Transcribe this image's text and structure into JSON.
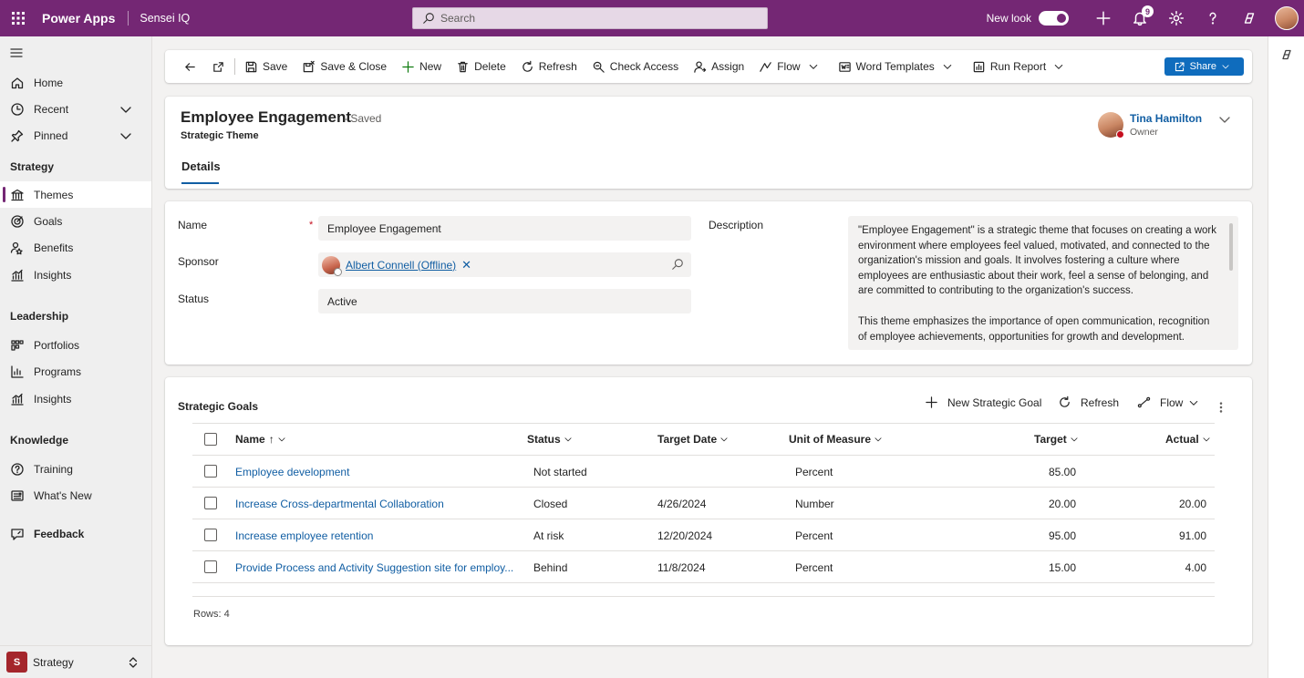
{
  "topbar": {
    "brand": "Power Apps",
    "app_name": "Sensei IQ",
    "search_placeholder": "Search",
    "new_look_label": "New look",
    "notification_count": "9"
  },
  "nav": {
    "items_top": [
      {
        "label": "Home"
      },
      {
        "label": "Recent"
      },
      {
        "label": "Pinned"
      }
    ],
    "sections": [
      {
        "title": "Strategy",
        "items": [
          "Themes",
          "Goals",
          "Benefits",
          "Insights"
        ]
      },
      {
        "title": "Leadership",
        "items": [
          "Portfolios",
          "Programs",
          "Insights"
        ]
      },
      {
        "title": "Knowledge",
        "items": [
          "Training",
          "What's New"
        ]
      }
    ],
    "feedback": "Feedback",
    "area": {
      "badge": "S",
      "label": "Strategy"
    }
  },
  "commands": {
    "save": "Save",
    "save_close": "Save & Close",
    "new": "New",
    "delete": "Delete",
    "refresh": "Refresh",
    "check_access": "Check Access",
    "assign": "Assign",
    "flow": "Flow",
    "word_templates": "Word Templates",
    "run_report": "Run Report",
    "share": "Share"
  },
  "record": {
    "title": "Employee Engagement",
    "saved_status": "- Saved",
    "entity": "Strategic Theme",
    "tab": "Details",
    "owner_name": "Tina Hamilton",
    "owner_label": "Owner"
  },
  "form": {
    "name_label": "Name",
    "name_value": "Employee Engagement",
    "required_mark": "*",
    "sponsor_label": "Sponsor",
    "sponsor_value": "Albert Connell (Offline)",
    "status_label": "Status",
    "status_value": "Active",
    "description_label": "Description",
    "description_p1": "\"Employee Engagement\" is a strategic theme that focuses on creating a work environment where employees feel valued, motivated, and connected to the organization's mission and goals. It involves fostering a culture where employees are enthusiastic about their work, feel a sense of belonging, and are committed to contributing to the organization's success.",
    "description_p2": "This theme emphasizes the importance of open communication, recognition of employee achievements, opportunities for growth and development."
  },
  "grid": {
    "title": "Strategic Goals",
    "new_label": "New Strategic Goal",
    "refresh_label": "Refresh",
    "flow_label": "Flow",
    "columns": {
      "name": "Name",
      "sort_indicator": "↑",
      "status": "Status",
      "target_date": "Target Date",
      "unit": "Unit of Measure",
      "target": "Target",
      "actual": "Actual"
    },
    "rows": [
      {
        "name": "Employee development",
        "status": "Not started",
        "target_date": "",
        "unit": "Percent",
        "target": "85.00",
        "actual": ""
      },
      {
        "name": "Increase Cross-departmental Collaboration",
        "status": "Closed",
        "target_date": "4/26/2024",
        "unit": "Number",
        "target": "20.00",
        "actual": "20.00"
      },
      {
        "name": "Increase employee retention",
        "status": "At risk",
        "target_date": "12/20/2024",
        "unit": "Percent",
        "target": "95.00",
        "actual": "91.00"
      },
      {
        "name": "Provide Process and Activity Suggestion site for employ...",
        "status": "Behind",
        "target_date": "11/8/2024",
        "unit": "Percent",
        "target": "15.00",
        "actual": "4.00"
      }
    ],
    "rows_count": "Rows: 4"
  }
}
